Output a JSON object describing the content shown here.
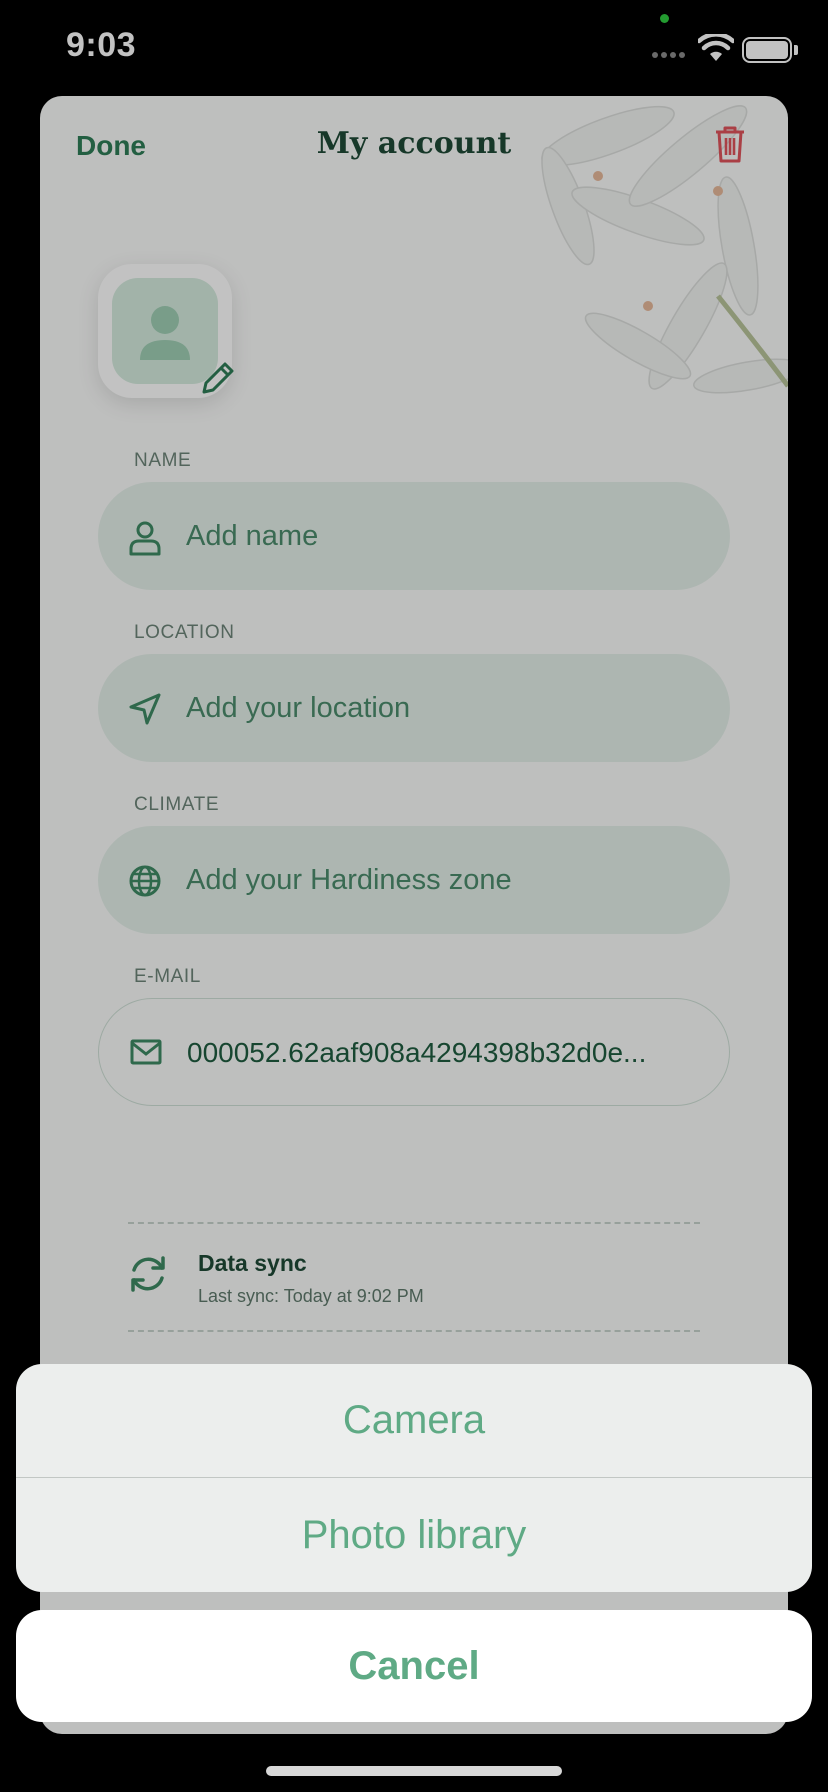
{
  "status_bar": {
    "time": "9:03"
  },
  "header": {
    "done_label": "Done",
    "title": "My account"
  },
  "fields": {
    "name": {
      "label": "NAME",
      "placeholder": "Add name"
    },
    "location": {
      "label": "LOCATION",
      "placeholder": "Add your location"
    },
    "climate": {
      "label": "CLIMATE",
      "placeholder": "Add your Hardiness zone"
    },
    "email": {
      "label": "E-MAIL",
      "value": "000052.62aaf908a4294398b32d0e..."
    }
  },
  "sync": {
    "title": "Data sync",
    "subtitle": "Last sync: Today at 9:02 PM"
  },
  "action_sheet": {
    "options": [
      "Camera",
      "Photo library"
    ],
    "cancel_label": "Cancel"
  },
  "colors": {
    "accent": "#2f7e57",
    "action_text": "#5faa85",
    "delete": "#e0535b",
    "field_fill": "#e4f0e9"
  }
}
